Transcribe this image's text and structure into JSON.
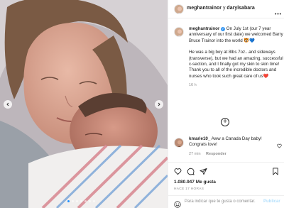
{
  "post": {
    "author": "meghantrainor",
    "joiner": "y",
    "coauthor": "darylsabara",
    "caption": {
      "username": "meghantrainor",
      "text": "On July 1st (our 7 year anniversary of our first date) we welcomed Barry Bruce Trainor into the world",
      "text_emoji": "🐯💙",
      "paragraph2": "He was a big boy at 8lbs 7oz...and sideways (transverse), but we had an amazing, successful c-section, and I finally got my skin to skin time! Thank you to all of the incredible doctors and nurses who took such great care of us",
      "paragraph2_emoji": "❤️",
      "time": "16 h"
    },
    "comments": [
      {
        "username": "kmarie10_",
        "text": "Aww a Canada Day baby! Congrats love!",
        "time": "27 min",
        "reply_label": "Responder"
      }
    ],
    "likes": "1.080.947 Me gusta",
    "posted_ago": "HACE 17 HORAS",
    "add_comment": {
      "placeholder": "Para indicar que te gusta o comentar.",
      "publish_label": "Publicar"
    },
    "carousel": {
      "total": 7,
      "active": 0
    }
  },
  "icons": {
    "more": "more-options-icon",
    "verified": "verified-badge-icon",
    "like": "heart-icon",
    "comment": "comment-icon",
    "share": "paper-plane-icon",
    "save": "bookmark-icon",
    "emoji": "smiley-icon",
    "add": "plus-circle-icon"
  },
  "colors": {
    "verified": "#3897f0",
    "carousel_active": "#1e90ff",
    "muted_text": "#8e8e8e",
    "publish_disabled": "#b2dffc"
  }
}
